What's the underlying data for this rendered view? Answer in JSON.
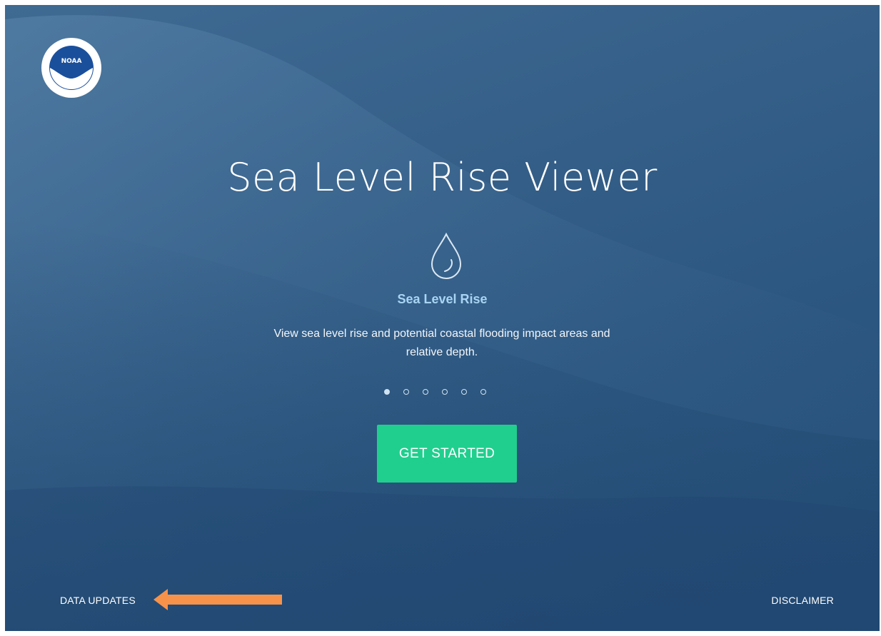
{
  "logo": {
    "text": "NOAA",
    "icon": "noaa-logo"
  },
  "hero": {
    "title": "Sea Level Rise Viewer"
  },
  "slide": {
    "icon": "water-drop-icon",
    "heading": "Sea Level Rise",
    "description": "View sea level rise and potential coastal flooding impact areas and relative depth.",
    "total_slides": 6,
    "active_slide": 1
  },
  "cta": {
    "label": "GET STARTED",
    "color": "#20cf8e"
  },
  "footer": {
    "data_updates": "DATA UPDATES",
    "disclaimer": "DISCLAIMER"
  },
  "annotation": {
    "icon": "orange-arrow-icon",
    "color": "#f7924a"
  },
  "colors": {
    "background": "#2f5a84",
    "heading_accent": "#a9d4f3"
  }
}
